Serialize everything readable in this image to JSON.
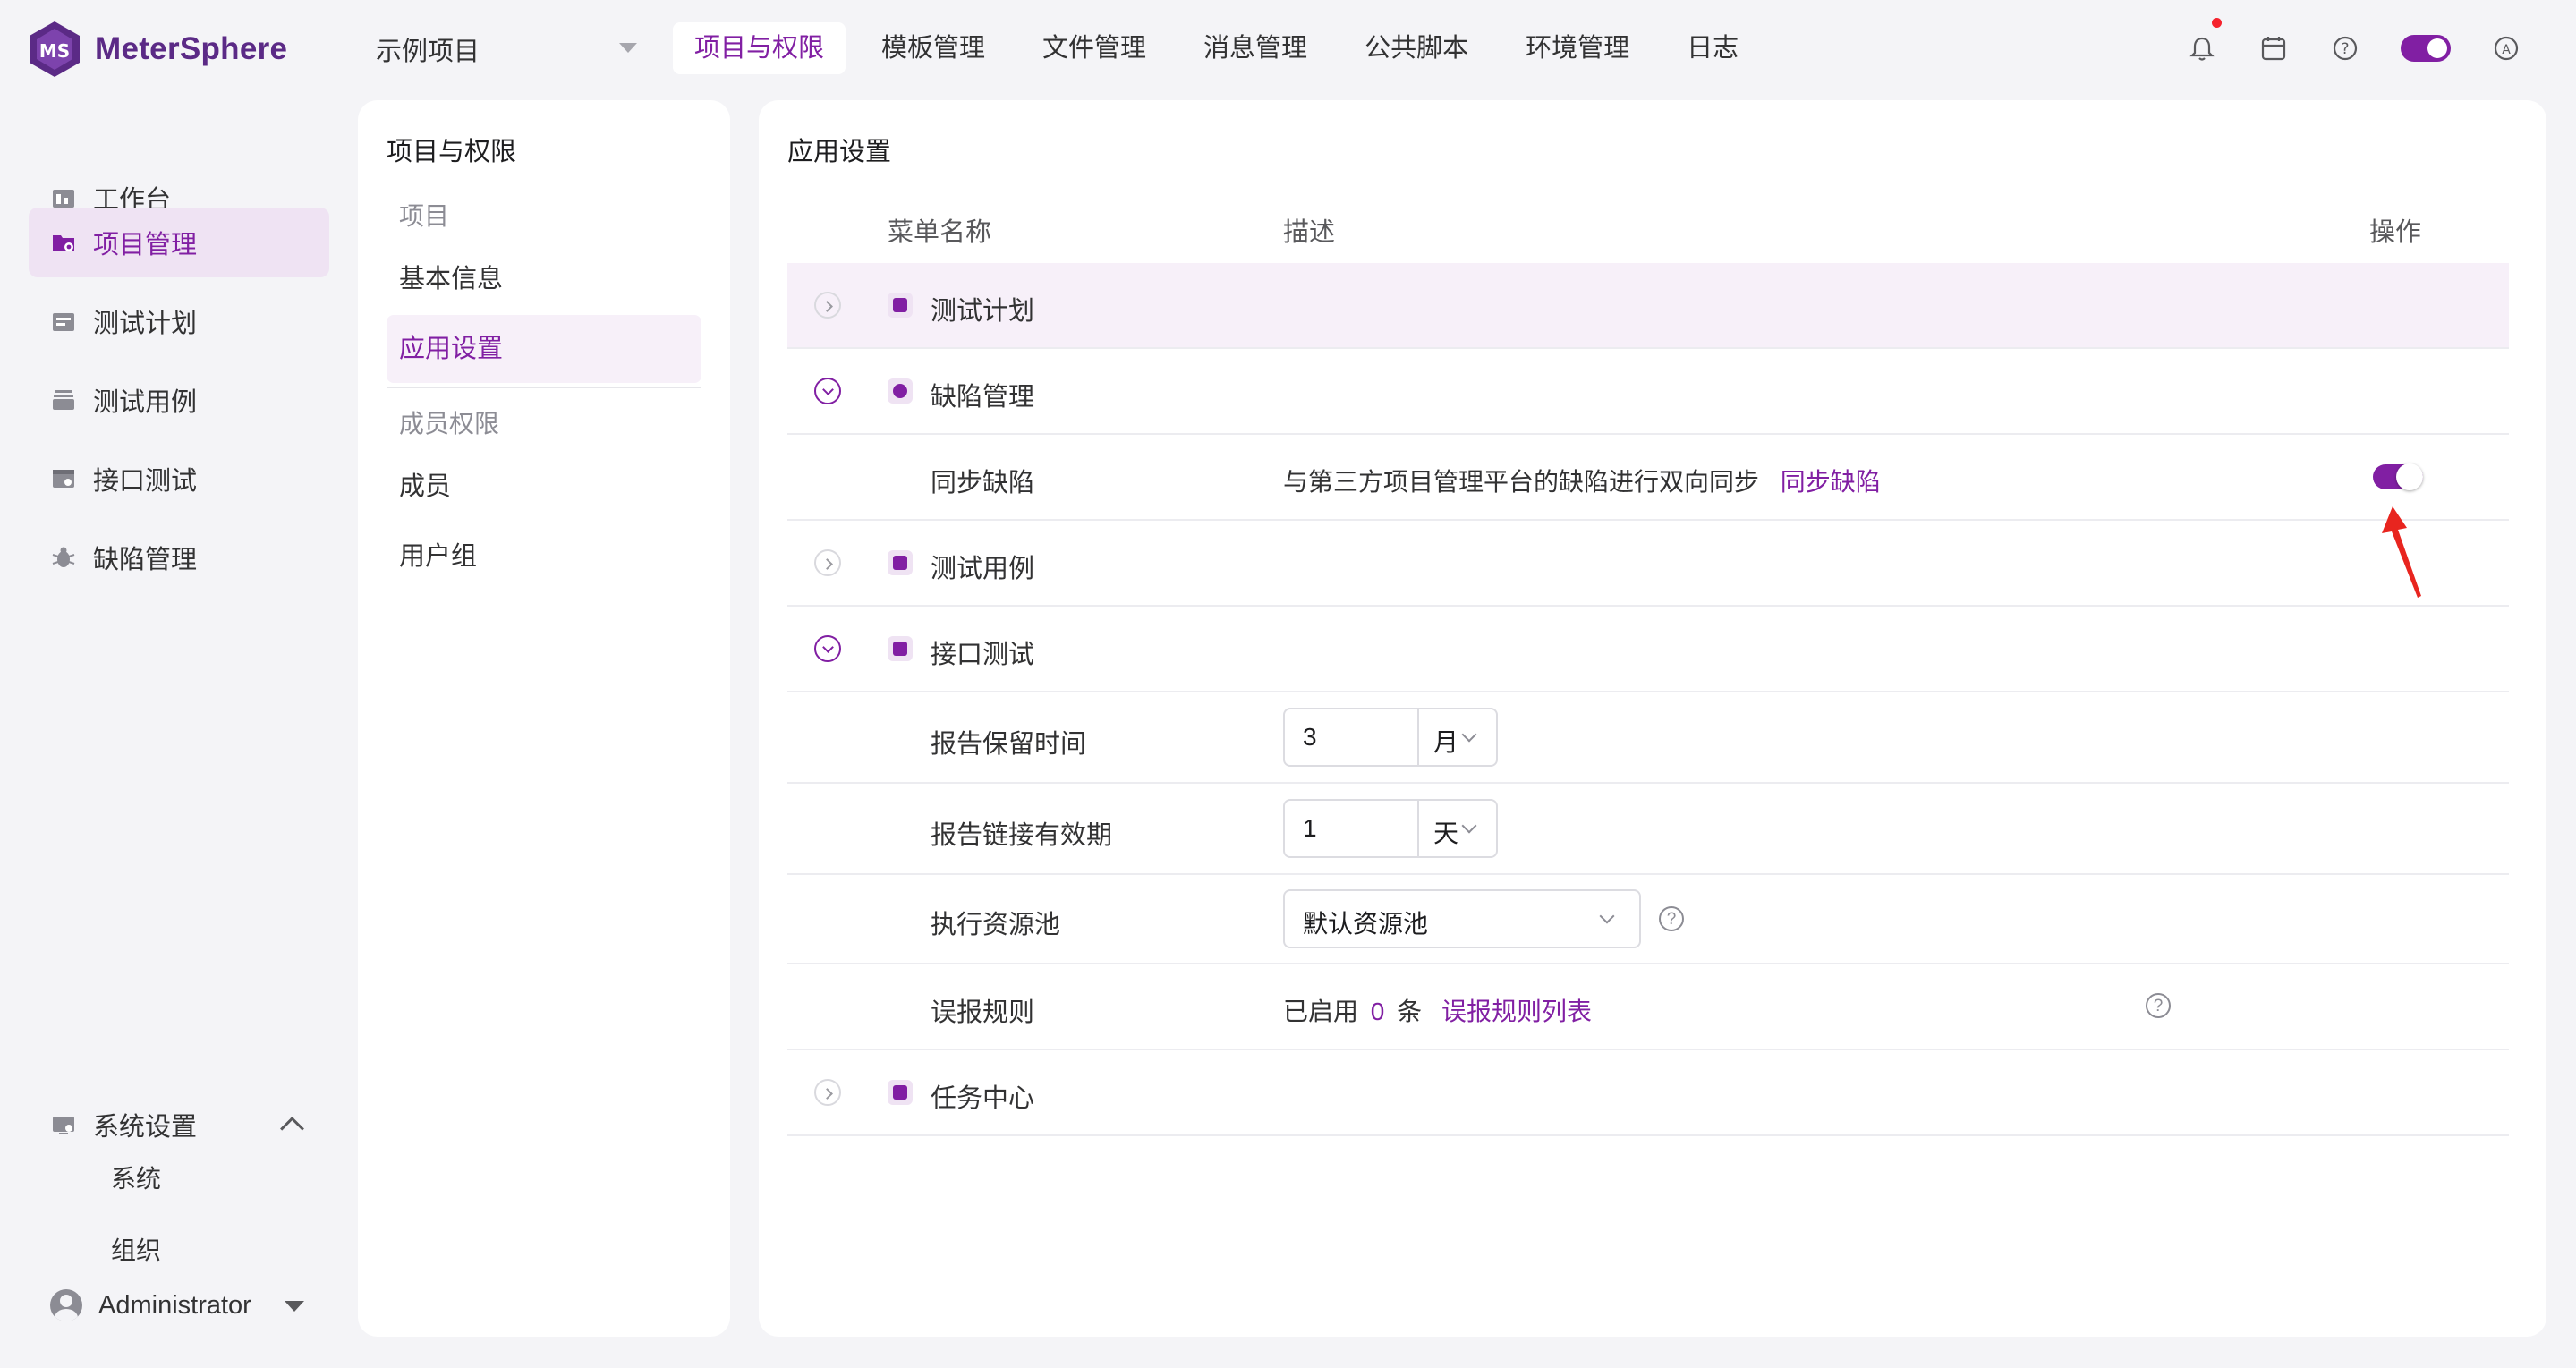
{
  "app": {
    "name": "MeterSphere",
    "logo_letters": "MS"
  },
  "header": {
    "project": "示例项目",
    "nav": [
      "项目与权限",
      "模板管理",
      "文件管理",
      "消息管理",
      "公共脚本",
      "环境管理",
      "日志"
    ],
    "active_nav": "项目与权限",
    "icons": [
      "bell-icon",
      "calendar-icon",
      "help-icon",
      "dark-mode-toggle",
      "language-icon"
    ]
  },
  "sidebar": {
    "items": [
      {
        "label": "工作台",
        "icon": "workbench-icon"
      },
      {
        "label": "项目管理",
        "icon": "project-icon",
        "active": true
      },
      {
        "label": "测试计划",
        "icon": "test-plan-icon"
      },
      {
        "label": "测试用例",
        "icon": "test-case-icon"
      },
      {
        "label": "接口测试",
        "icon": "api-test-icon"
      },
      {
        "label": "缺陷管理",
        "icon": "bug-icon"
      }
    ],
    "system": {
      "label": "系统设置",
      "children": [
        "系统",
        "组织"
      ]
    },
    "user": "Administrator"
  },
  "submenu": {
    "title": "项目与权限",
    "groups": [
      {
        "label": "项目",
        "items": [
          "基本信息",
          "应用设置"
        ]
      },
      {
        "label": "成员权限",
        "items": [
          "成员",
          "用户组"
        ]
      }
    ],
    "active": "应用设置"
  },
  "main": {
    "title": "应用设置",
    "columns": [
      "菜单名称",
      "描述",
      "操作"
    ],
    "rows": {
      "test_plan": {
        "label": "测试计划"
      },
      "bug": {
        "label": "缺陷管理"
      },
      "bug_sync": {
        "label": "同步缺陷",
        "desc": "与第三方项目管理平台的缺陷进行双向同步",
        "link": "同步缺陷",
        "enabled": true
      },
      "test_case": {
        "label": "测试用例"
      },
      "api": {
        "label": "接口测试"
      },
      "report_retention": {
        "label": "报告保留时间",
        "value": "3",
        "unit": "月"
      },
      "report_link": {
        "label": "报告链接有效期",
        "value": "1",
        "unit": "天"
      },
      "resource_pool": {
        "label": "执行资源池",
        "value": "默认资源池"
      },
      "false_alarm": {
        "label": "误报规则",
        "prefix": "已启用",
        "count": "0",
        "suffix": "条",
        "link": "误报规则列表"
      },
      "task_center": {
        "label": "任务中心"
      }
    }
  },
  "colors": {
    "accent": "#811fa3",
    "annotation_arrow": "#e8251f"
  }
}
